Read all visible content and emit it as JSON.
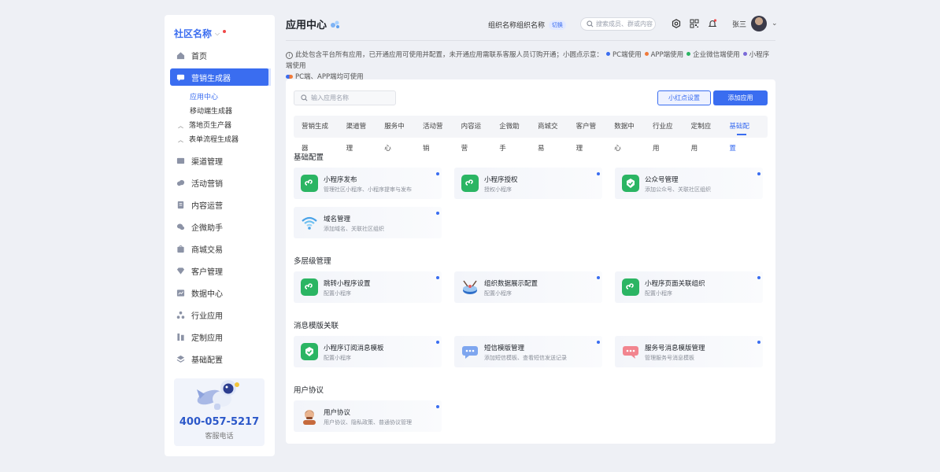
{
  "sidebar": {
    "community_name": "社区名称",
    "items": [
      {
        "label": "首页",
        "icon": "home-icon"
      },
      {
        "label": "营销生成器",
        "icon": "chat-icon",
        "active": true
      },
      {
        "label": "渠道管理",
        "icon": "channel-icon"
      },
      {
        "label": "活动营销",
        "icon": "cloud-icon"
      },
      {
        "label": "内容运营",
        "icon": "document-icon"
      },
      {
        "label": "企微助手",
        "icon": "wechat-icon"
      },
      {
        "label": "商城交易",
        "icon": "shop-icon"
      },
      {
        "label": "客户管理",
        "icon": "diamond-icon"
      },
      {
        "label": "数据中心",
        "icon": "chart-icon"
      },
      {
        "label": "行业应用",
        "icon": "nodes-icon"
      },
      {
        "label": "定制应用",
        "icon": "custom-icon"
      },
      {
        "label": "基础配置",
        "icon": "layers-icon"
      }
    ],
    "sub_items": [
      {
        "label": "应用中心",
        "active": true
      },
      {
        "label": "移动端生成器"
      },
      {
        "label": "落地页生产器",
        "group": true
      },
      {
        "label": "表单流程生成器",
        "group": true
      }
    ],
    "hotline_number": "400-057-5217",
    "hotline_label": "客服电话"
  },
  "header": {
    "title": "应用中心",
    "org_name": "组织名称组织名称",
    "switch_label": "切换",
    "search_placeholder": "搜索成员、群或内容",
    "user_name": "张三"
  },
  "notice": {
    "text": "此处包含平台所有应用，已开通应用可使用并配置，未开通应用需联系客服人员订购开通；小圆点示意：",
    "legend": [
      {
        "label": "PC端使用",
        "color": "#3a6df0"
      },
      {
        "label": "APP端使用",
        "color": "#f07a3a"
      },
      {
        "label": "企业微信端使用",
        "color": "#2bb563"
      },
      {
        "label": "小程序端使用",
        "color": "#7a6ad8"
      }
    ],
    "combo_label": "PC端、APP端均可使用"
  },
  "main": {
    "search_placeholder": "输入应用名称",
    "btn_secondary": "小红点设置",
    "btn_primary": "添加应用",
    "tabs": [
      "营销生成器",
      "渠道管理",
      "服务中心",
      "活动营销",
      "内容运营",
      "企微助手",
      "商城交易",
      "客户管理",
      "数据中心",
      "行业应用",
      "定制应用",
      "基础配置"
    ],
    "active_tab": "基础配置",
    "sections": [
      {
        "title": "基础配置",
        "cards": [
          {
            "title": "小程序发布",
            "desc": "管理社区小程序、小程序提审与发布",
            "icon": "mini-program-icon"
          },
          {
            "title": "小程序授权",
            "desc": "授权小程序",
            "icon": "mini-program-icon"
          },
          {
            "title": "公众号管理",
            "desc": "添加公众号、关联社区组织",
            "icon": "verified-icon"
          },
          {
            "title": "域名管理",
            "desc": "添加域名、关联社区组织",
            "icon": "wifi-icon"
          }
        ]
      },
      {
        "title": "多层级管理",
        "cards": [
          {
            "title": "跳转小程序设置",
            "desc": "配置小程序",
            "icon": "mini-program-icon"
          },
          {
            "title": "组织数据展示配置",
            "desc": "配置小程序",
            "icon": "data-display-icon"
          },
          {
            "title": "小程序页面关联组织",
            "desc": "配置小程序",
            "icon": "mini-program-icon"
          }
        ]
      },
      {
        "title": "消息模版关联",
        "cards": [
          {
            "title": "小程序订阅消息模板",
            "desc": "配置小程序",
            "icon": "verified-icon"
          },
          {
            "title": "短信模版管理",
            "desc": "添加短信模板、查看短信发送记录",
            "icon": "sms-icon"
          },
          {
            "title": "服务号消息模版管理",
            "desc": "管理服务号消息模板",
            "icon": "message-icon"
          }
        ]
      },
      {
        "title": "用户协议",
        "cards": [
          {
            "title": "用户协议",
            "desc": "用户协议、隐私政策、普通协议管理",
            "icon": "user-avatar-icon"
          }
        ]
      }
    ]
  }
}
